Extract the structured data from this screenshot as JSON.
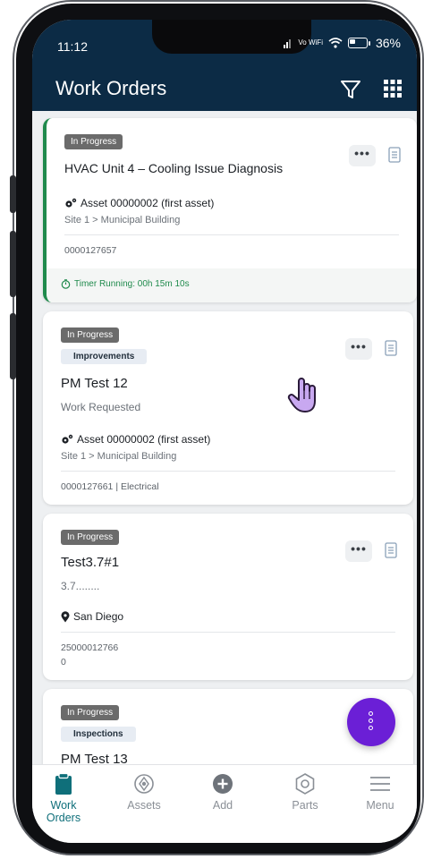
{
  "status_bar": {
    "time": "11:12",
    "network": "Vo WiFi",
    "battery": "36%"
  },
  "app_bar": {
    "title": "Work Orders",
    "filter_icon": "filter-icon",
    "grid_icon": "apps-grid-icon"
  },
  "work_orders": [
    {
      "status": "In Progress",
      "title": "HVAC Unit 4 – Cooling Issue Diagnosis",
      "asset": "Asset 00000002 (first asset)",
      "site": "Site 1 > Municipal Building",
      "id_line": "0000127657",
      "timer": "Timer Running: 00h 15m 10s"
    },
    {
      "status": "In Progress",
      "category": "Improvements",
      "title": "PM Test 12",
      "subtitle": "Work Requested",
      "asset": "Asset 00000002 (first asset)",
      "site": "Site 1 > Municipal Building",
      "id_line": "0000127661 | Electrical"
    },
    {
      "status": "In Progress",
      "title": "Test3.7#1",
      "subtitle": "3.7........",
      "location": "San Diego",
      "id_line": "25000012766",
      "id_line2": "0"
    },
    {
      "status": "In Progress",
      "category": "Inspections",
      "title": "PM Test 13"
    }
  ],
  "more_label": "•••",
  "bottom_nav": [
    {
      "label": "Work Orders",
      "icon": "clipboard-icon",
      "active": true
    },
    {
      "label": "Assets",
      "icon": "asset-icon"
    },
    {
      "label": "Add",
      "icon": "add-icon"
    },
    {
      "label": "Parts",
      "icon": "parts-icon"
    },
    {
      "label": "Menu",
      "icon": "menu-icon"
    }
  ],
  "colors": {
    "header": "#0c2b45",
    "status_badge": "#6b6b6b",
    "timer_green": "#1f8a4c",
    "fab": "#6b1fd6",
    "nav_active": "#0f6f7a"
  }
}
